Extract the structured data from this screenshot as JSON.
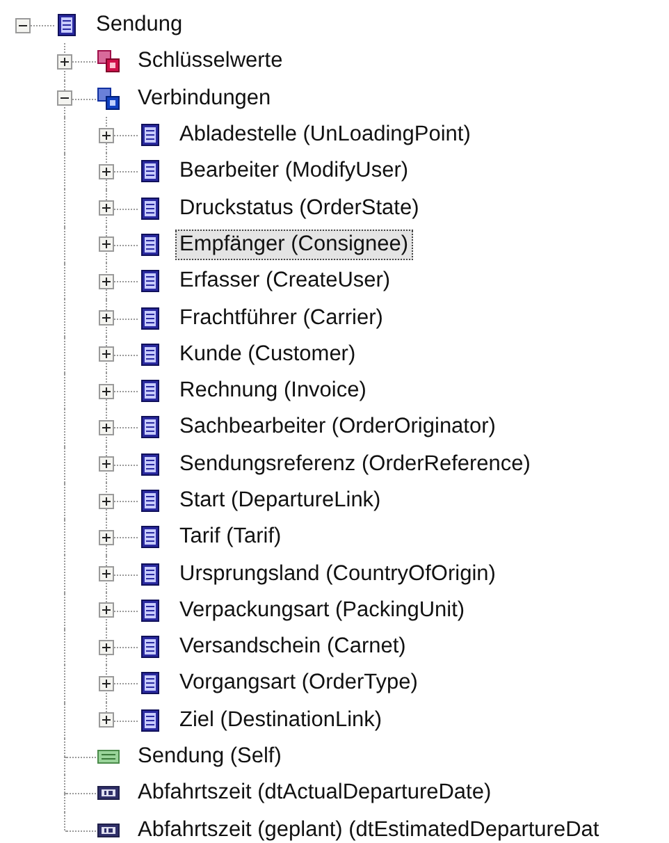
{
  "tree": [
    {
      "label": "Sendung",
      "kind": "entity",
      "expanded": true,
      "selected": false,
      "children": [
        {
          "label": "Schlüsselwerte",
          "kind": "keys",
          "expanded": false,
          "selected": false
        },
        {
          "label": "Verbindungen",
          "kind": "relations",
          "expanded": true,
          "selected": false,
          "children": [
            {
              "label": "Abladestelle (UnLoadingPoint)",
              "kind": "entity",
              "expanded": false,
              "selected": false
            },
            {
              "label": "Bearbeiter (ModifyUser)",
              "kind": "entity",
              "expanded": false,
              "selected": false
            },
            {
              "label": "Druckstatus (OrderState)",
              "kind": "entity",
              "expanded": false,
              "selected": false
            },
            {
              "label": "Empfänger (Consignee)",
              "kind": "entity",
              "expanded": false,
              "selected": true
            },
            {
              "label": "Erfasser (CreateUser)",
              "kind": "entity",
              "expanded": false,
              "selected": false
            },
            {
              "label": "Frachtführer (Carrier)",
              "kind": "entity",
              "expanded": false,
              "selected": false
            },
            {
              "label": "Kunde (Customer)",
              "kind": "entity",
              "expanded": false,
              "selected": false
            },
            {
              "label": "Rechnung (Invoice)",
              "kind": "entity",
              "expanded": false,
              "selected": false
            },
            {
              "label": "Sachbearbeiter (OrderOriginator)",
              "kind": "entity",
              "expanded": false,
              "selected": false
            },
            {
              "label": "Sendungsreferenz (OrderReference)",
              "kind": "entity",
              "expanded": false,
              "selected": false
            },
            {
              "label": "Start (DepartureLink)",
              "kind": "entity",
              "expanded": false,
              "selected": false
            },
            {
              "label": "Tarif (Tarif)",
              "kind": "entity",
              "expanded": false,
              "selected": false
            },
            {
              "label": "Ursprungsland (CountryOfOrigin)",
              "kind": "entity",
              "expanded": false,
              "selected": false
            },
            {
              "label": "Verpackungsart (PackingUnit)",
              "kind": "entity",
              "expanded": false,
              "selected": false
            },
            {
              "label": "Versandschein (Carnet)",
              "kind": "entity",
              "expanded": false,
              "selected": false
            },
            {
              "label": "Vorgangsart (OrderType)",
              "kind": "entity",
              "expanded": false,
              "selected": false
            },
            {
              "label": "Ziel (DestinationLink)",
              "kind": "entity",
              "expanded": false,
              "selected": false
            }
          ]
        },
        {
          "label": "Sendung (Self)",
          "kind": "self",
          "selected": false
        },
        {
          "label": "Abfahrtszeit (dtActualDepartureDate)",
          "kind": "field",
          "selected": false
        },
        {
          "label": "Abfahrtszeit (geplant) (dtEstimatedDepartureDat",
          "kind": "field",
          "selected": false
        }
      ]
    }
  ]
}
